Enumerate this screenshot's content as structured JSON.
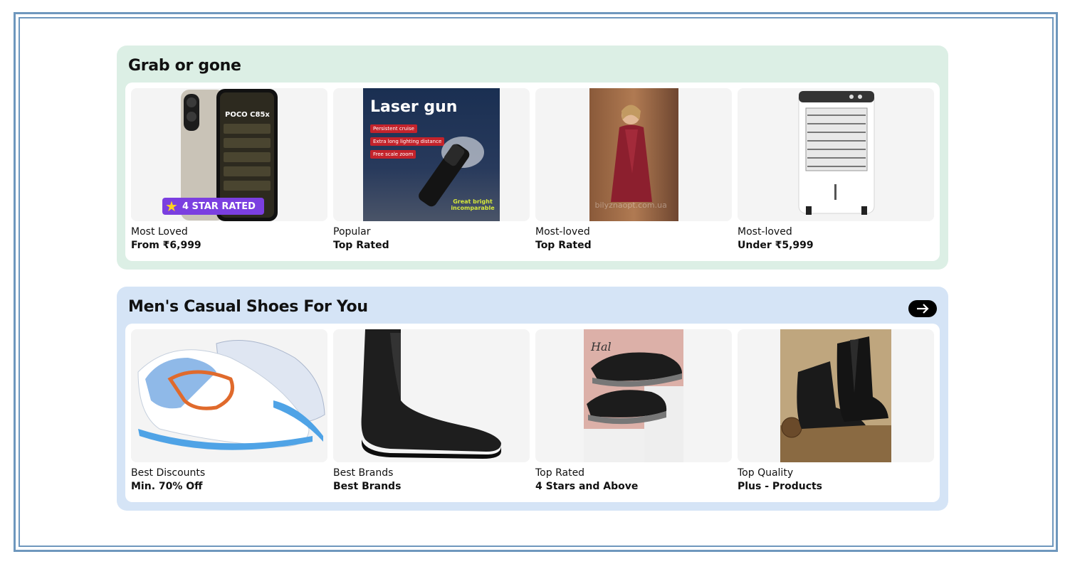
{
  "sections": [
    {
      "title": "Grab or gone",
      "cards": [
        {
          "label": "Most Loved",
          "value": "From ₹6,999",
          "image": "poco-phone-image",
          "badge": "4 STAR RATED",
          "phone_brand": "POCO C85x"
        },
        {
          "label": "Popular",
          "value": "Top Rated",
          "image": "laser-flashlight-image",
          "headline": "Laser gun",
          "tags": [
            "Persistent cruise",
            "Extra long lighting distance",
            "Free scale zoom"
          ],
          "corner_text": "Great bright incomparable"
        },
        {
          "label": "Most-loved",
          "value": "Top Rated",
          "image": "satin-robe-image",
          "watermark": "bilyznaopt.com.ua"
        },
        {
          "label": "Most-loved",
          "value": "Under ₹5,999",
          "image": "air-cooler-image"
        }
      ]
    },
    {
      "title": "Men's Casual Shoes For You",
      "arrow": "arrow-right-icon",
      "cards": [
        {
          "label": "Best Discounts",
          "value": "Min. 70% Off",
          "image": "running-shoes-image"
        },
        {
          "label": "Best Brands",
          "value": "Best Brands",
          "image": "chelsea-boot-image"
        },
        {
          "label": "Top Rated",
          "value": "4 Stars and Above",
          "image": "black-sneakers-image"
        },
        {
          "label": "Top Quality",
          "value": "Plus - Products",
          "image": "leather-boots-image"
        }
      ]
    }
  ],
  "colors": {
    "section1_bg": "#dcefe5",
    "section2_bg": "#d5e4f6",
    "frame": "#6e97bd"
  }
}
